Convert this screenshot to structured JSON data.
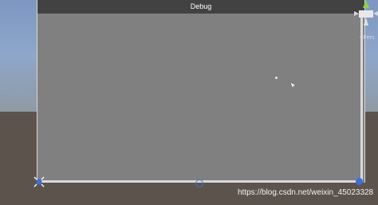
{
  "debug_window": {
    "title": "Debug"
  },
  "scene_gizmo": {
    "projection_label": "<Pers"
  },
  "watermark": {
    "text": "https://blog.csdn.net/weixin_45023328"
  },
  "colors": {
    "panel_gray": "#808080",
    "titlebar": "#424242",
    "selection_handle_blue": "#3e6de0"
  },
  "icons": {
    "cursor": "arrow-cursor-icon",
    "move_handle": "move-handle-icon",
    "pivot": "pivot-handle-icon"
  }
}
